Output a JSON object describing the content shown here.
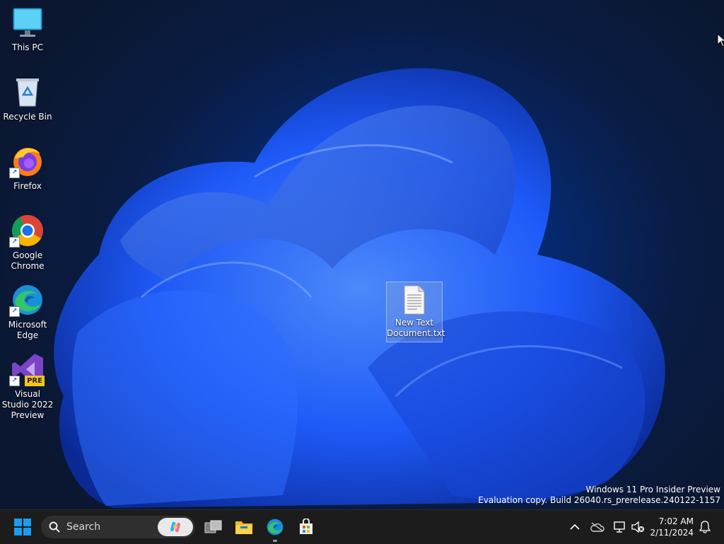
{
  "desktop": {
    "icons": [
      {
        "label": "This PC",
        "icon": "this-pc-icon"
      },
      {
        "label": "Recycle Bin",
        "icon": "recycle-bin-icon"
      },
      {
        "label": "Firefox",
        "icon": "firefox-icon"
      },
      {
        "label": "Google Chrome",
        "icon": "chrome-icon"
      },
      {
        "label": "Microsoft Edge",
        "icon": "edge-icon"
      },
      {
        "label": "Visual Studio 2022 Preview",
        "icon": "visual-studio-icon",
        "badge": "PRE"
      }
    ],
    "selected_file": {
      "label": "New Text Document.txt",
      "icon": "text-document-icon"
    }
  },
  "watermark": {
    "line1": "Windows 11 Pro Insider Preview",
    "line2": "Evaluation copy. Build 26040.rs_prerelease.240122-1157"
  },
  "taskbar": {
    "search_placeholder": "Search",
    "pinned": [
      "start-icon",
      "task-view-icon",
      "file-explorer-icon",
      "edge-icon",
      "microsoft-store-icon"
    ],
    "tray": {
      "time": "7:02 AM",
      "date": "2/11/2024"
    }
  },
  "colors": {
    "taskbar_bg": "#1c1c1c",
    "wallpaper_accent": "#1f5cff",
    "start_blue": "#1a9cf0"
  }
}
